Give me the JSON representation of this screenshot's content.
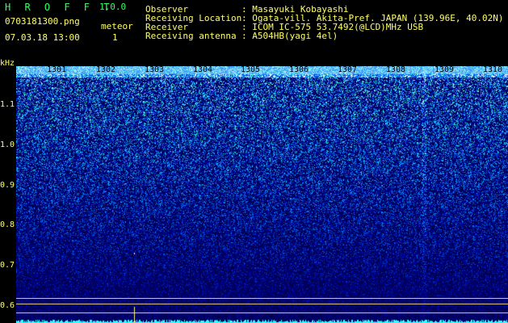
{
  "header": {
    "app_name": "H R O F F T",
    "version": "1.0.0",
    "file_name": "0703181300.png",
    "meteor_label": "meteor",
    "datetime": "07.03.18 13:00",
    "meteor_count": "1"
  },
  "info": [
    {
      "key": "Observer",
      "value": ": Masayuki Kobayashi"
    },
    {
      "key": "Receiving Location",
      "value": ": Ogata-vill. Akita-Pref. JAPAN (139.96E, 40.02N)"
    },
    {
      "key": "Receiver",
      "value": ": ICOM IC-575 53.7492(@LCD)MHz USB"
    },
    {
      "key": "Receiving antenna",
      "value": ": A504HB(yagi 4el)"
    }
  ],
  "axis": {
    "y_unit": "kHz",
    "y_ticks": [
      "1.1",
      "1.0",
      "0.9",
      "0.8",
      "0.7",
      "0.6"
    ],
    "x_ticks": [
      "1301",
      "1302",
      "1303",
      "1304",
      "1305",
      "1306",
      "1307",
      "1308",
      "1309",
      "1310"
    ]
  },
  "colors": {
    "label_yellow": "#ffff66",
    "title_green": "#33ff66",
    "noise_base": "#00005a",
    "signal_cyan": "#33ffff"
  }
}
